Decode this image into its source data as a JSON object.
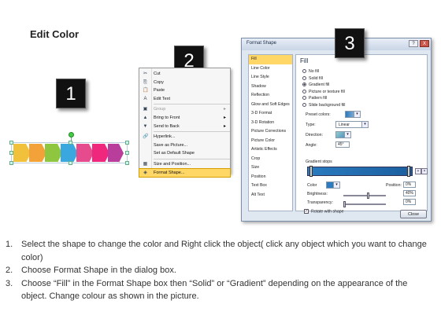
{
  "title": "Edit Color",
  "badges": {
    "one": "1",
    "two": "2",
    "three": "3"
  },
  "strip_colors": [
    "#f2c13c",
    "#f3a23a",
    "#8ec63f",
    "#3aa7df",
    "#e64b8e",
    "#f0287d",
    "#b93e9c"
  ],
  "context_menu": {
    "items": [
      {
        "label": "Cut",
        "icon": "✂",
        "disabled": false
      },
      {
        "label": "Copy",
        "icon": "⎘",
        "disabled": false
      },
      {
        "label": "Paste",
        "icon": "📋",
        "disabled": false
      },
      {
        "label": "Edit Text",
        "icon": "A",
        "disabled": false
      },
      {
        "label": "Group",
        "icon": "▣",
        "disabled": true,
        "submenu": true
      },
      {
        "label": "Bring to Front",
        "icon": "▲",
        "disabled": false,
        "submenu": true
      },
      {
        "label": "Send to Back",
        "icon": "▼",
        "disabled": false,
        "submenu": true
      },
      {
        "label": "Hyperlink...",
        "icon": "🔗",
        "disabled": false
      },
      {
        "label": "Save as Picture...",
        "icon": "",
        "disabled": false
      },
      {
        "label": "Set as Default Shape",
        "icon": "",
        "disabled": false
      },
      {
        "label": "Size and Position...",
        "icon": "▦",
        "disabled": false
      },
      {
        "label": "Format Shape...",
        "icon": "◈",
        "disabled": false,
        "selected": true
      }
    ]
  },
  "dialog": {
    "title": "Format Shape",
    "title_buttons": {
      "help": "?",
      "close": "X"
    },
    "nav": [
      "Fill",
      "Line Color",
      "Line Style",
      "Shadow",
      "Reflection",
      "Glow and Soft Edges",
      "3-D Format",
      "3-D Rotation",
      "Picture Corrections",
      "Picture Color",
      "Artistic Effects",
      "Crop",
      "Size",
      "Position",
      "Text Box",
      "Alt Text"
    ],
    "section_title": "Fill",
    "fill_options": [
      "No fill",
      "Solid fill",
      "Gradient fill",
      "Picture or texture fill",
      "Pattern fill",
      "Slide background fill"
    ],
    "selected_fill": "Gradient fill",
    "preset_colors_label": "Preset colors:",
    "type_label": "Type:",
    "type_value": "Linear",
    "direction_label": "Direction:",
    "angle_label": "Angle:",
    "angle_value": "45°",
    "gradient_stops_label": "Gradient stops",
    "color_label": "Color",
    "position_label": "Position:",
    "position_value": "0%",
    "brightness_label": "Brightness:",
    "brightness_value": "40%",
    "transparency_label": "Transparency:",
    "transparency_value": "0%",
    "rotate_label": "Rotate with shape",
    "rotate_checked": true,
    "close_label": "Close"
  },
  "instructions": [
    {
      "num": "1.",
      "text": "Select the shape to change the color and Right click the object( click any object which you want to change color)"
    },
    {
      "num": "2.",
      "text": "Choose Format Shape in the dialog box."
    },
    {
      "num": "3.",
      "text": "Choose “Fill” in the Format Shape box then “Solid” or “Gradient” depending on the appearance of the object. Change colour as shown in the picture."
    }
  ]
}
